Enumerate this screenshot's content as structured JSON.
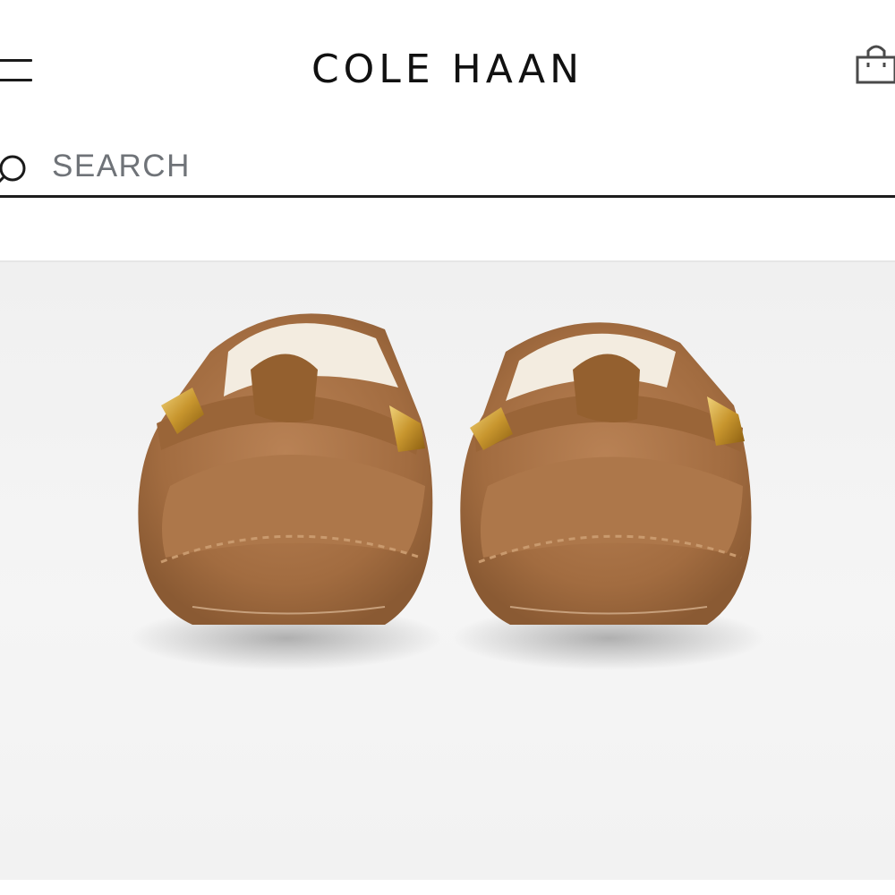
{
  "header": {
    "brand": "COLE HAAN",
    "menu_icon": "hamburger-menu-icon",
    "cart_icon": "shopping-bag-icon"
  },
  "search": {
    "placeholder": "SEARCH",
    "icon": "search-icon"
  },
  "product": {
    "image": "suede-moccasin-slippers-with-gold-bit",
    "colors": {
      "suede": "#a77245",
      "gold": "#c8962e",
      "shearling": "#f3ece0"
    }
  }
}
